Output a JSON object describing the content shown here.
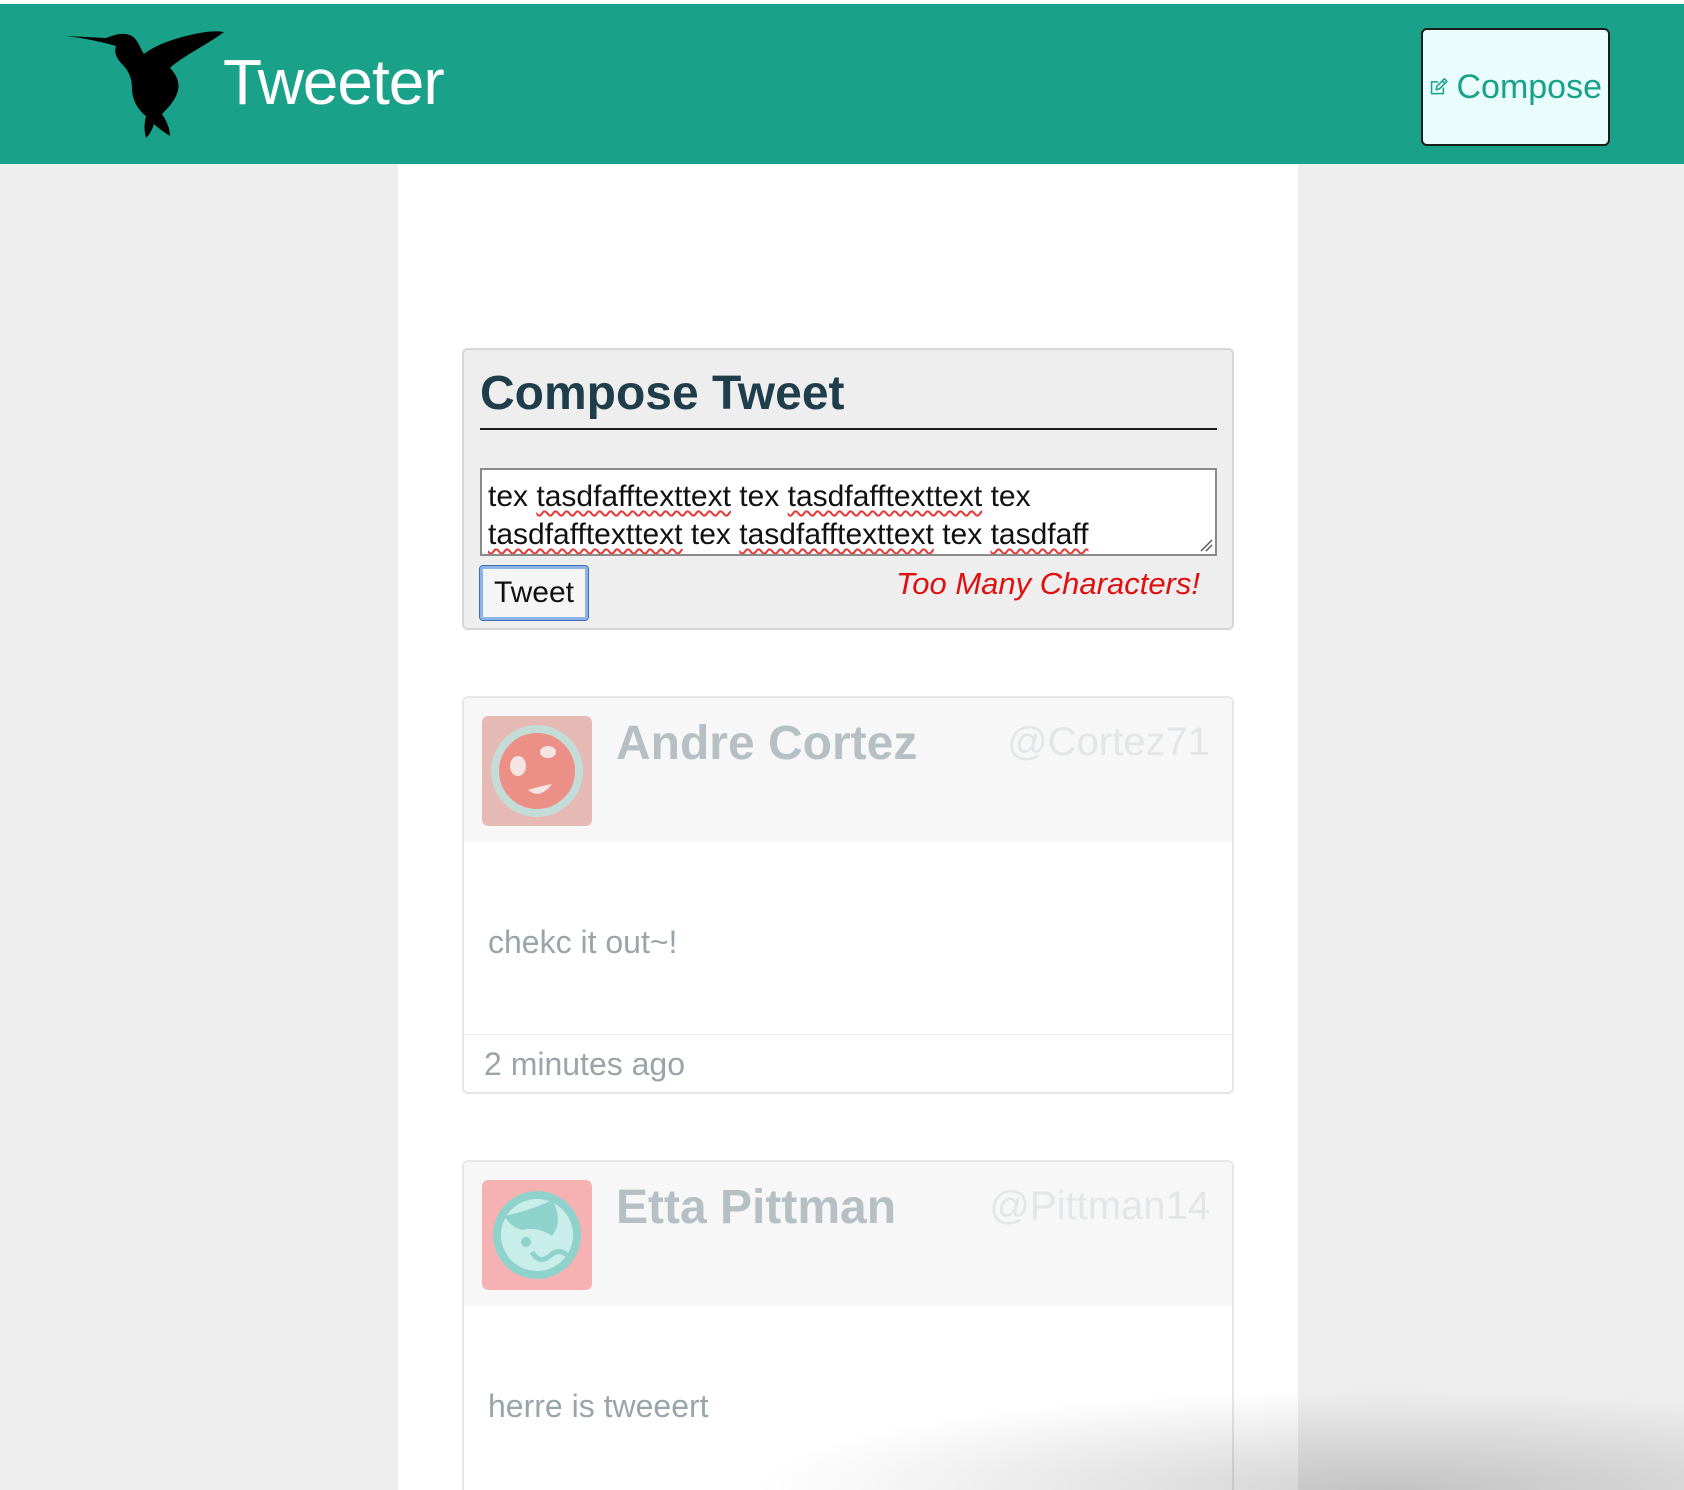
{
  "app": {
    "brand": "Tweeter"
  },
  "nav": {
    "compose_label": "Compose",
    "compose_icon": "edit-icon",
    "color_bar": "#1aa189"
  },
  "compose": {
    "title": "Compose Tweet",
    "text_line_1": [
      "tex",
      "tasdfafftexttext",
      "tex",
      "tasdfafftexttext",
      "tex"
    ],
    "text_line_2": [
      "tasdfafftexttext",
      "tex",
      "tasdfafftexttext",
      "tex",
      "tasdfaff"
    ],
    "submit_label": "Tweet",
    "error": "Too Many Characters!",
    "error_color": "#e01010"
  },
  "tweets": [
    {
      "name": "Andre Cortez",
      "handle": "@Cortez71",
      "body": "chekc it out~!",
      "time": "2 minutes ago",
      "avatar_bg": "#e6b9b5",
      "avatar_fg": "#c4dcd8"
    },
    {
      "name": "Etta Pittman",
      "handle": "@Pittman14",
      "body": "herre is tweeert",
      "avatar_bg": "#f6b2b2",
      "avatar_fg": "#8fd2cc"
    }
  ]
}
